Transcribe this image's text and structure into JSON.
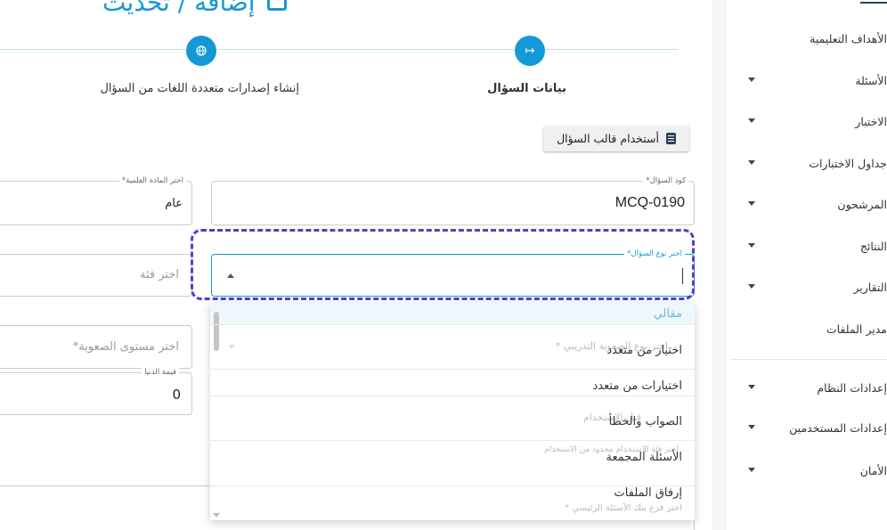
{
  "page": {
    "title": "إضافة / تحديث"
  },
  "stepper": {
    "steps": [
      {
        "label": "بيانات السؤال",
        "icon": "arrow-right-icon"
      },
      {
        "label": "إنشاء إصدارات متعددة اللغات من السؤال",
        "icon": "globe-icon"
      }
    ]
  },
  "template_button": {
    "label": "أستخدام قالب السؤال",
    "icon": "document-icon"
  },
  "form": {
    "question_code": {
      "label": "كود السؤال*",
      "value": "MCQ-0190"
    },
    "subject": {
      "label": "اختر المادة العلمية*",
      "value": "عام"
    },
    "question_type": {
      "label": "اختر نوع السؤال*",
      "value": ""
    },
    "category": {
      "placeholder": "اختر فئة"
    },
    "difficulty": {
      "placeholder": "اختر مستوى الصعوبة*"
    },
    "min_value": {
      "label": "قيمة الدنيا",
      "value": "0"
    }
  },
  "dropdown": {
    "options": [
      "مقالي",
      "اختيار من متعدد",
      "اختيارات من متعدد",
      "الصواب والخطأ",
      "الأسئلة المجمعة",
      "إرفاق الملفات"
    ],
    "ghost_texts": [
      "اختر نوع الصعوبة التدريبي *",
      "قبل الاستخدام",
      "اختر فئة للاستخدام محدود من الاستخدام",
      "اختر فرع بنك الأسئلة الرئيسي *"
    ]
  },
  "sidebar": {
    "items": [
      {
        "label": "الأهداف التعليمية",
        "caret": false
      },
      {
        "label": "الأسئلة",
        "caret": true
      },
      {
        "label": "الاختبار",
        "caret": true
      },
      {
        "label": "جداول الاختبارات",
        "caret": true
      },
      {
        "label": "المرشحون",
        "caret": true
      },
      {
        "label": "النتائج",
        "caret": true
      },
      {
        "label": "التقارير",
        "caret": true
      },
      {
        "label": "مدير الملفات",
        "caret": false
      },
      {
        "label": "إعدادات النظام",
        "caret": true
      },
      {
        "label": "إعدادات المستخدمين",
        "caret": true
      },
      {
        "label": "الأمان",
        "caret": true
      }
    ]
  },
  "colors": {
    "primary": "#1599d6",
    "focus_outline": "#5040c8",
    "sidebar_bg": "#ffffff"
  }
}
